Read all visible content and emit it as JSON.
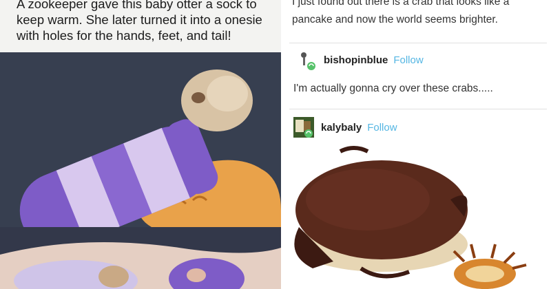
{
  "left_post": {
    "caption_lines": [
      "A zookeeper gave this baby otter a sock to",
      "keep warm. She later turned it into a onesie",
      "with holes for the hands, feet, and tail!"
    ]
  },
  "right_post": {
    "original_text_lines": [
      "I just found out there is a crab that looks like a",
      "pancake and now the world seems brighter."
    ],
    "reblogs": [
      {
        "username": "bishopinblue",
        "follow_label": "Follow",
        "comment": "I'm actually gonna cry over these crabs....."
      },
      {
        "username": "kalybaly",
        "follow_label": "Follow"
      }
    ]
  },
  "colors": {
    "follow": "#54b6e3",
    "sock_purple": "#7e5cc7",
    "sock_lilac": "#d8c8ee",
    "crab_brown": "#5a2a1c"
  },
  "icons": [
    "reblog-badge-icon"
  ]
}
